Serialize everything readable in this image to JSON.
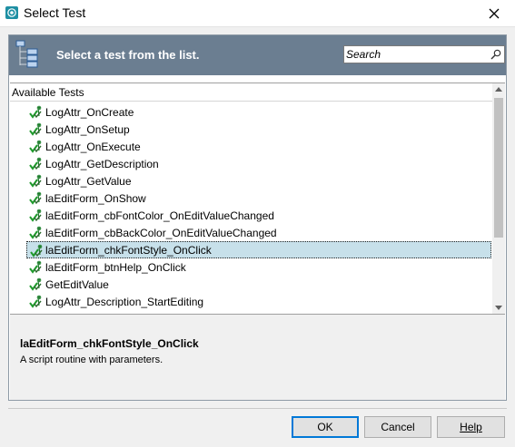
{
  "window": {
    "title": "Select Test"
  },
  "header": {
    "prompt": "Select a test from the list."
  },
  "search": {
    "placeholder": "Search"
  },
  "list": {
    "column_header": "Available Tests",
    "items": [
      {
        "label": "LogAttr_OnCreate",
        "selected": false
      },
      {
        "label": "LogAttr_OnSetup",
        "selected": false
      },
      {
        "label": "LogAttr_OnExecute",
        "selected": false
      },
      {
        "label": "LogAttr_GetDescription",
        "selected": false
      },
      {
        "label": "LogAttr_GetValue",
        "selected": false
      },
      {
        "label": "laEditForm_OnShow",
        "selected": false
      },
      {
        "label": "laEditForm_cbFontColor_OnEditValueChanged",
        "selected": false
      },
      {
        "label": "laEditForm_cbBackColor_OnEditValueChanged",
        "selected": false
      },
      {
        "label": "laEditForm_chkFontStyle_OnClick",
        "selected": true
      },
      {
        "label": "laEditForm_btnHelp_OnClick",
        "selected": false
      },
      {
        "label": "GetEditValue",
        "selected": false
      },
      {
        "label": "LogAttr_Description_StartEditing",
        "selected": false
      }
    ]
  },
  "description": {
    "title": "laEditForm_chkFontStyle_OnClick",
    "text": "A script routine with parameters."
  },
  "buttons": {
    "ok": "OK",
    "cancel": "Cancel",
    "help": "Help"
  },
  "colors": {
    "header_band": "#6b7e91",
    "selection": "#c7e0ea",
    "accent": "#0078d7"
  }
}
